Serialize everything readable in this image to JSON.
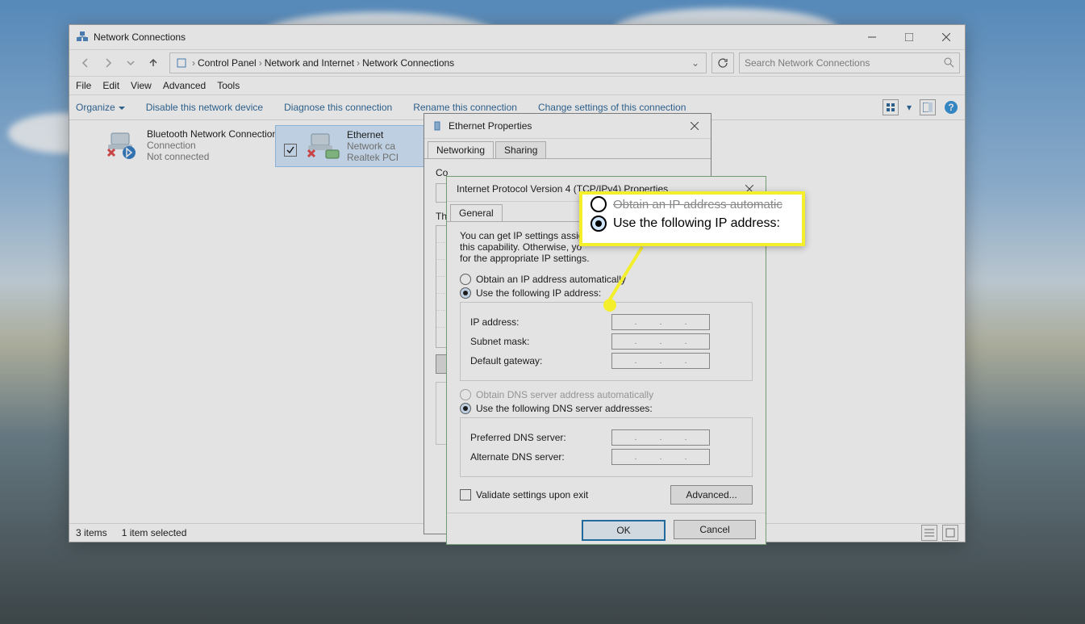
{
  "window": {
    "title": "Network Connections",
    "breadcrumbs": [
      "Control Panel",
      "Network and Internet",
      "Network Connections"
    ],
    "search_placeholder": "Search Network Connections",
    "menus": {
      "file": "File",
      "edit": "Edit",
      "view": "View",
      "advanced": "Advanced",
      "tools": "Tools"
    },
    "commands": {
      "organize": "Organize",
      "disable": "Disable this network device",
      "diagnose": "Diagnose this connection",
      "rename": "Rename this connection",
      "change": "Change settings of this connection"
    },
    "status": {
      "items": "3 items",
      "selected": "1 item selected"
    }
  },
  "adapters": [
    {
      "name": "Bluetooth Network Connection",
      "line2": "Connection",
      "state": "Not connected"
    },
    {
      "name": "Ethernet",
      "line2": "Network ca",
      "line3": "Realtek PCI"
    }
  ],
  "eth_dialog": {
    "title": "Ethernet Properties",
    "tabs": {
      "networking": "Networking",
      "sharing": "Sharing"
    },
    "connect_using": "Co"
  },
  "ipv4_dialog": {
    "title": "Internet Protocol Version 4 (TCP/IPv4) Properties",
    "tab": "General",
    "desc1": "You can get IP settings assigr",
    "desc2": "this capability. Otherwise, yo",
    "desc3": "for the appropriate IP settings.",
    "radio_auto_ip": "Obtain an IP address automatically",
    "radio_manual_ip": "Use the following IP address:",
    "fields": {
      "ip": "IP address:",
      "subnet": "Subnet mask:",
      "gateway": "Default gateway:"
    },
    "radio_auto_dns": "Obtain DNS server address automatically",
    "radio_manual_dns": "Use the following DNS server addresses:",
    "dns_fields": {
      "preferred": "Preferred DNS server:",
      "alternate": "Alternate DNS server:"
    },
    "validate": "Validate settings upon exit",
    "advanced": "Advanced...",
    "ok": "OK",
    "cancel": "Cancel"
  },
  "callout": {
    "line_top": "Obtain an IP address automatic",
    "line_main": "Use the following IP address:"
  }
}
